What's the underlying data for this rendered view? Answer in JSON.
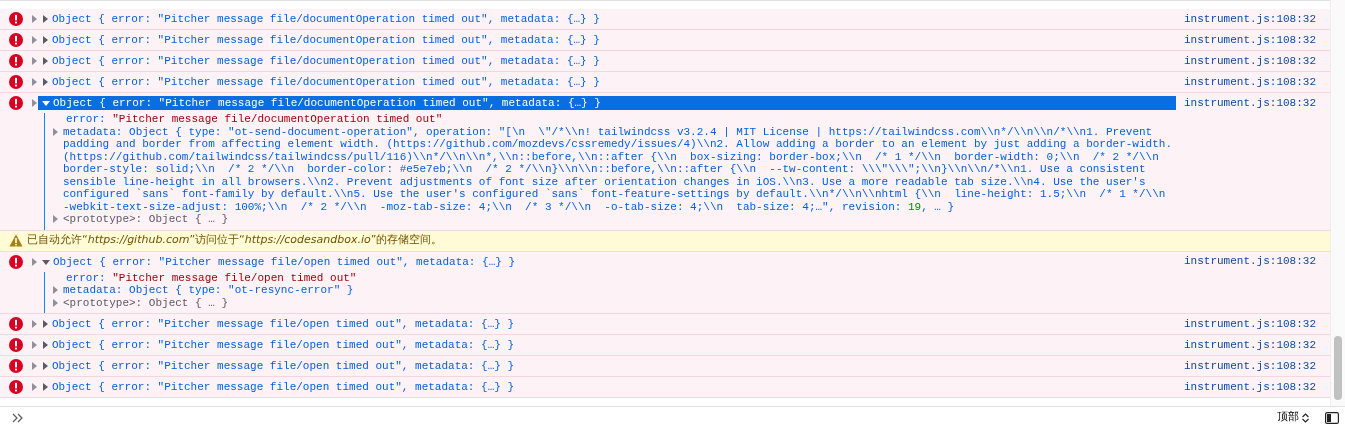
{
  "messages": [
    {
      "kind": "error",
      "expanded": false,
      "selected": false,
      "summary": "Object { error: \"Pitcher message file/documentOperation timed out\", metadata: {…} }",
      "source": "instrument.js:108:32"
    },
    {
      "kind": "error",
      "expanded": false,
      "selected": false,
      "summary": "Object { error: \"Pitcher message file/documentOperation timed out\", metadata: {…} }",
      "source": "instrument.js:108:32"
    },
    {
      "kind": "error",
      "expanded": false,
      "selected": false,
      "summary": "Object { error: \"Pitcher message file/documentOperation timed out\", metadata: {…} }",
      "source": "instrument.js:108:32"
    },
    {
      "kind": "error",
      "expanded": false,
      "selected": false,
      "summary": "Object { error: \"Pitcher message file/documentOperation timed out\", metadata: {…} }",
      "source": "instrument.js:108:32"
    },
    {
      "kind": "error",
      "expanded": true,
      "selected": true,
      "summary": "Object { error: \"Pitcher message file/documentOperation timed out\", metadata: {…} }",
      "source": "instrument.js:108:32",
      "properties": [
        {
          "kind": "string",
          "key": "error:",
          "value": "\"Pitcher message file/documentOperation timed out\""
        },
        {
          "kind": "object",
          "expanded": false,
          "key": "metadata:",
          "value": "Object { type: \"ot-send-document-operation\", operation: \"[\\n  \\\"/*\\\\n! tailwindcss v3.2.4 | MIT License | https://tailwindcss.com\\\\n*/\\\\n\\\\n/*\\\\n1. Prevent padding and border from affecting element width. (https://github.com/mozdevs/cssremedy/issues/4)\\\\n2. Allow adding a border to an element by just adding a border-width. (https://github.com/tailwindcss/tailwindcss/pull/116)\\\\n*/\\\\n\\\\n*,\\\\n::before,\\\\n::after {\\\\n  box-sizing: border-box;\\\\n  /* 1 */\\\\n  border-width: 0;\\\\n  /* 2 */\\\\n  border-style: solid;\\\\n  /* 2 */\\\\n  border-color: #e5e7eb;\\\\n  /* 2 */\\\\n}\\\\n\\\\n::before,\\\\n::after {\\\\n  --tw-content: \\\\\\\"\\\\\\\";\\\\n}\\\\n\\\\n/*\\\\n1. Use a consistent sensible line-height in all browsers.\\\\n2. Prevent adjustments of font size after orientation changes in iOS.\\\\n3. Use a more readable tab size.\\\\n4. Use the user's configured `sans` font-family by default.\\\\n5. Use the user's configured `sans` font-feature-settings by default.\\\\n*/\\\\n\\\\nhtml {\\\\n  line-height: 1.5;\\\\n  /* 1 */\\\\n  -webkit-text-size-adjust: 100%;\\\\n  /* 2 */\\\\n  -moz-tab-size: 4;\\\\n  /* 3 */\\\\n  -o-tab-size: 4;\\\\n  tab-size: 4;…\", revision:",
          "number": "19",
          "tail": ", … }"
        },
        {
          "kind": "prototype",
          "expanded": false,
          "key": "<prototype>:",
          "value": "Object { … }"
        }
      ]
    },
    {
      "kind": "warning",
      "text": "已自动允许“*https://github.com*”访问位于“*https://codesandbox.io*”的存储空间。"
    },
    {
      "kind": "error",
      "expanded": true,
      "selected": false,
      "summary": "Object { error: \"Pitcher message file/open timed out\", metadata: {…} }",
      "source": "instrument.js:108:32",
      "properties": [
        {
          "kind": "string",
          "key": "error:",
          "value": "\"Pitcher message file/open timed out\""
        },
        {
          "kind": "object",
          "expanded": false,
          "key": "metadata:",
          "value": "Object { type: \"ot-resync-error\" }"
        },
        {
          "kind": "prototype",
          "expanded": false,
          "key": "<prototype>:",
          "value": "Object { … }"
        }
      ]
    },
    {
      "kind": "error",
      "expanded": false,
      "selected": false,
      "summary": "Object { error: \"Pitcher message file/open timed out\", metadata: {…} }",
      "source": "instrument.js:108:32"
    },
    {
      "kind": "error",
      "expanded": false,
      "selected": false,
      "summary": "Object { error: \"Pitcher message file/open timed out\", metadata: {…} }",
      "source": "instrument.js:108:32"
    },
    {
      "kind": "error",
      "expanded": false,
      "selected": false,
      "summary": "Object { error: \"Pitcher message file/open timed out\", metadata: {…} }",
      "source": "instrument.js:108:32"
    },
    {
      "kind": "error",
      "expanded": false,
      "selected": false,
      "summary": "Object { error: \"Pitcher message file/open timed out\", metadata: {…} }",
      "source": "instrument.js:108:32"
    }
  ],
  "input_bar": {
    "context": "顶部"
  }
}
